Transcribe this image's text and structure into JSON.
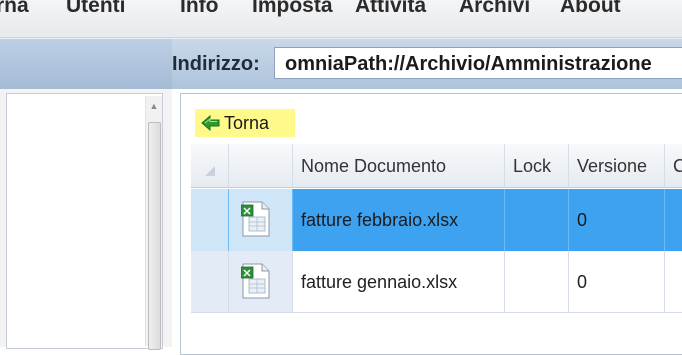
{
  "menu": {
    "items": [
      "rna",
      "Utenti",
      "Info",
      "Imposta",
      "Attività",
      "Archivi",
      "About"
    ]
  },
  "address": {
    "label": "Indirizzo:",
    "value": "omniaPath://Archivio/Amministrazione"
  },
  "toolbar": {
    "back_label": "Torna"
  },
  "grid": {
    "columns": [
      "Nome Documento",
      "Lock",
      "Versione",
      "Cl"
    ],
    "rows": [
      {
        "name": "fatture febbraio.xlsx",
        "lock": "",
        "version": "0",
        "selected": true
      },
      {
        "name": "fatture gennaio.xlsx",
        "lock": "",
        "version": "0",
        "selected": false
      }
    ]
  },
  "colors": {
    "selection": "#3da2f0",
    "back_highlight": "#fff98a"
  },
  "icons": [
    "scroll-up-arrow-icon",
    "back-arrow-icon",
    "excel-file-icon"
  ]
}
